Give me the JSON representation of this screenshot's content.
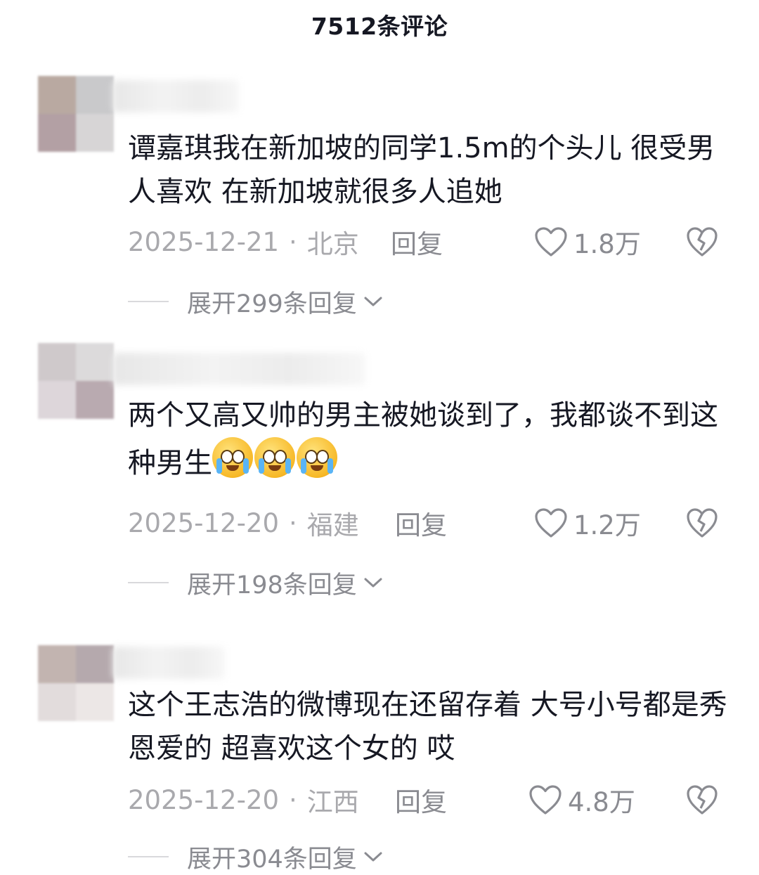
{
  "header": {
    "title": "7512条评论"
  },
  "comments": [
    {
      "text": "谭嘉琪我在新加坡的同学1.5m的个头儿 很受男人喜欢 在新加坡就很多人追她",
      "date": "2025-12-21",
      "location": "北京",
      "reply_label": "回复",
      "likes": "1.8万",
      "expand_label": "展开299条回复"
    },
    {
      "text": "两个又高又帅的男主被她谈到了，我都谈不到这种男生",
      "date": "2025-12-20",
      "location": "福建",
      "reply_label": "回复",
      "likes": "1.2万",
      "expand_label": "展开198条回复",
      "emoji": "crying-face-emoji"
    },
    {
      "text": "这个王志浩的微博现在还留存着 大号小号都是秀恩爱的 超喜欢这个女的 哎",
      "date": "2025-12-20",
      "location": "江西",
      "reply_label": "回复",
      "likes": "4.8万",
      "expand_label": "展开304条回复"
    }
  ],
  "colors": {
    "text_primary": "#161823",
    "text_secondary": "#a9a9ad",
    "action_gray": "#8a8b91"
  },
  "icons": {
    "like": "heart-outline-icon",
    "dislike": "broken-heart-icon",
    "expand": "chevron-down-icon"
  }
}
